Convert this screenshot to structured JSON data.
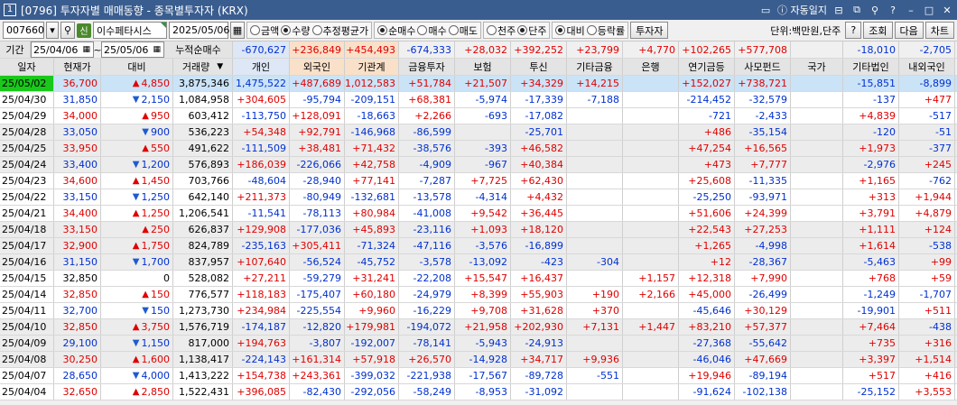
{
  "window": {
    "num": "1",
    "title": "[0796] 투자자별 매매동향 - 종목별투자자 (KRX)",
    "autolog": "자동일지",
    "help": "?"
  },
  "toolbar": {
    "code": "007660",
    "shin": "신",
    "name": "이수페타시스",
    "date": "2025/05/06",
    "radios1": [
      {
        "label": "금액",
        "on": false
      },
      {
        "label": "수량",
        "on": true
      },
      {
        "label": "추정평균가",
        "on": false
      }
    ],
    "radios2": [
      {
        "label": "순매수",
        "on": true
      },
      {
        "label": "매수",
        "on": false
      },
      {
        "label": "매도",
        "on": false
      }
    ],
    "radios3": [
      {
        "label": "천주",
        "on": false
      },
      {
        "label": "단주",
        "on": true
      }
    ],
    "radios4": [
      {
        "label": "대비",
        "on": true
      },
      {
        "label": "등락률",
        "on": false
      }
    ],
    "investor_btn": "투자자",
    "unit": "단위:백만원,단주",
    "q_btn": "?",
    "search_btn": "조회",
    "next_btn": "다음",
    "chart_btn": "차트"
  },
  "summary": {
    "period_label": "기간",
    "from": "25/04/06",
    "to": "25/05/06",
    "cum_label": "누적순매수",
    "values": [
      "-670,627",
      "+236,849",
      "+454,493",
      "-674,333",
      "+28,032",
      "+392,252",
      "+23,799",
      "+4,770",
      "+102,265",
      "+577,708",
      "",
      "-18,010",
      "-2,705"
    ]
  },
  "headers": [
    "일자",
    "현재가",
    "대비",
    "거래량",
    "개인",
    "외국인",
    "기관계",
    "금융투자",
    "보험",
    "투신",
    "기타금융",
    "은행",
    "연기금등",
    "사모펀드",
    "국가",
    "기타법인",
    "내외국인"
  ],
  "rows": [
    [
      "25/05/02",
      "36,700",
      "up",
      "4,850",
      "3,875,346",
      "1,475,522",
      "+487,689",
      "1,012,583",
      "+51,784",
      "+21,507",
      "+34,329",
      "+14,215",
      "",
      "+152,027",
      "+738,721",
      "",
      "-15,851",
      "-8,899"
    ],
    [
      "25/04/30",
      "31,850",
      "dn",
      "2,150",
      "1,084,958",
      "+304,605",
      "-95,794",
      "-209,151",
      "+68,381",
      "-5,974",
      "-17,339",
      "-7,188",
      "",
      "-214,452",
      "-32,579",
      "",
      "-137",
      "+477"
    ],
    [
      "25/04/29",
      "34,000",
      "up",
      "950",
      "603,412",
      "-113,750",
      "+128,091",
      "-18,663",
      "+2,266",
      "-693",
      "-17,082",
      "",
      "",
      "-721",
      "-2,433",
      "",
      "+4,839",
      "-517"
    ],
    [
      "25/04/28",
      "33,050",
      "dn",
      "900",
      "536,223",
      "+54,348",
      "+92,791",
      "-146,968",
      "-86,599",
      "",
      "-25,701",
      "",
      "",
      "+486",
      "-35,154",
      "",
      "-120",
      "-51"
    ],
    [
      "25/04/25",
      "33,950",
      "up",
      "550",
      "491,622",
      "-111,509",
      "+38,481",
      "+71,432",
      "-38,576",
      "-393",
      "+46,582",
      "",
      "",
      "+47,254",
      "+16,565",
      "",
      "+1,973",
      "-377"
    ],
    [
      "25/04/24",
      "33,400",
      "dn",
      "1,200",
      "576,893",
      "+186,039",
      "-226,066",
      "+42,758",
      "-4,909",
      "-967",
      "+40,384",
      "",
      "",
      "+473",
      "+7,777",
      "",
      "-2,976",
      "+245"
    ],
    [
      "25/04/23",
      "34,600",
      "up",
      "1,450",
      "703,766",
      "-48,604",
      "-28,940",
      "+77,141",
      "-7,287",
      "+7,725",
      "+62,430",
      "",
      "",
      "+25,608",
      "-11,335",
      "",
      "+1,165",
      "-762"
    ],
    [
      "25/04/22",
      "33,150",
      "dn",
      "1,250",
      "642,140",
      "+211,373",
      "-80,949",
      "-132,681",
      "-13,578",
      "-4,314",
      "+4,432",
      "",
      "",
      "-25,250",
      "-93,971",
      "",
      "+313",
      "+1,944"
    ],
    [
      "25/04/21",
      "34,400",
      "up",
      "1,250",
      "1,206,541",
      "-11,541",
      "-78,113",
      "+80,984",
      "-41,008",
      "+9,542",
      "+36,445",
      "",
      "",
      "+51,606",
      "+24,399",
      "",
      "+3,791",
      "+4,879"
    ],
    [
      "25/04/18",
      "33,150",
      "up",
      "250",
      "626,837",
      "+129,908",
      "-177,036",
      "+45,893",
      "-23,116",
      "+1,093",
      "+18,120",
      "",
      "",
      "+22,543",
      "+27,253",
      "",
      "+1,111",
      "+124"
    ],
    [
      "25/04/17",
      "32,900",
      "up",
      "1,750",
      "824,789",
      "-235,163",
      "+305,411",
      "-71,324",
      "-47,116",
      "-3,576",
      "-16,899",
      "",
      "",
      "+1,265",
      "-4,998",
      "",
      "+1,614",
      "-538"
    ],
    [
      "25/04/16",
      "31,150",
      "dn",
      "1,700",
      "837,957",
      "+107,640",
      "-56,524",
      "-45,752",
      "-3,578",
      "-13,092",
      "-423",
      "-304",
      "",
      "+12",
      "-28,367",
      "",
      "-5,463",
      "+99"
    ],
    [
      "25/04/15",
      "32,850",
      "",
      "0",
      "528,082",
      "+27,211",
      "-59,279",
      "+31,241",
      "-22,208",
      "+15,547",
      "+16,437",
      "",
      "+1,157",
      "+12,318",
      "+7,990",
      "",
      "+768",
      "+59"
    ],
    [
      "25/04/14",
      "32,850",
      "up",
      "150",
      "776,577",
      "+118,183",
      "-175,407",
      "+60,180",
      "-24,979",
      "+8,399",
      "+55,903",
      "+190",
      "+2,166",
      "+45,000",
      "-26,499",
      "",
      "-1,249",
      "-1,707"
    ],
    [
      "25/04/11",
      "32,700",
      "dn",
      "150",
      "1,273,730",
      "+234,984",
      "-225,554",
      "+9,960",
      "-16,229",
      "+9,708",
      "+31,628",
      "+370",
      "",
      "-45,646",
      "+30,129",
      "",
      "-19,901",
      "+511"
    ],
    [
      "25/04/10",
      "32,850",
      "up",
      "3,750",
      "1,576,719",
      "-174,187",
      "-12,820",
      "+179,981",
      "-194,072",
      "+21,958",
      "+202,930",
      "+7,131",
      "+1,447",
      "+83,210",
      "+57,377",
      "",
      "+7,464",
      "-438"
    ],
    [
      "25/04/09",
      "29,100",
      "dn",
      "1,150",
      "817,000",
      "+194,763",
      "-3,807",
      "-192,007",
      "-78,141",
      "-5,943",
      "-24,913",
      "",
      "",
      "-27,368",
      "-55,642",
      "",
      "+735",
      "+316"
    ],
    [
      "25/04/08",
      "30,250",
      "up",
      "1,600",
      "1,138,417",
      "-224,143",
      "+161,314",
      "+57,918",
      "+26,570",
      "-14,928",
      "+34,717",
      "+9,936",
      "",
      "-46,046",
      "+47,669",
      "",
      "+3,397",
      "+1,514"
    ],
    [
      "25/04/07",
      "28,650",
      "dn",
      "4,000",
      "1,413,222",
      "+154,738",
      "+243,361",
      "-399,032",
      "-221,938",
      "-17,567",
      "-89,728",
      "-551",
      "",
      "+19,946",
      "-89,194",
      "",
      "+517",
      "+416"
    ],
    [
      "25/04/04",
      "32,650",
      "up",
      "2,850",
      "1,522,431",
      "+396,085",
      "-82,430",
      "-292,056",
      "-58,249",
      "-8,953",
      "-31,092",
      "",
      "",
      "-91,624",
      "-102,138",
      "",
      "-25,152",
      "+3,553"
    ]
  ]
}
